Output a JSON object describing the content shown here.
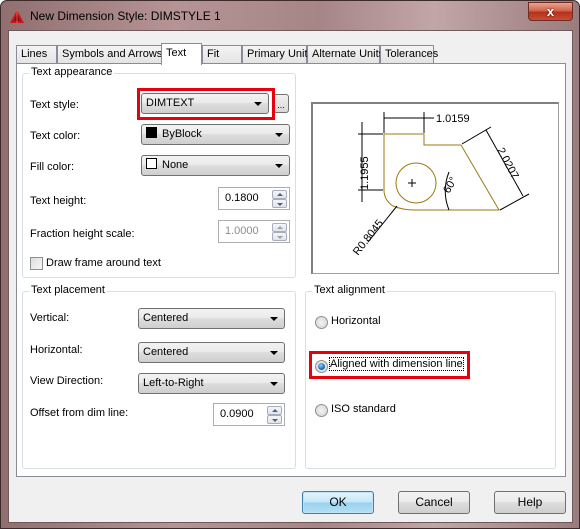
{
  "window": {
    "title": "New Dimension Style: DIMSTYLE 1",
    "close_label": "x"
  },
  "tabs": [
    {
      "label": "Lines",
      "active": false
    },
    {
      "label": "Symbols and Arrows",
      "active": false
    },
    {
      "label": "Text",
      "active": true
    },
    {
      "label": "Fit",
      "active": false
    },
    {
      "label": "Primary Units",
      "active": false
    },
    {
      "label": "Alternate Units",
      "active": false
    },
    {
      "label": "Tolerances",
      "active": false
    }
  ],
  "text_appearance": {
    "title": "Text appearance",
    "text_style_label": "Text style:",
    "text_style_value": "DIMTEXT",
    "text_style_browse": "...",
    "text_color_label": "Text color:",
    "text_color_value": "ByBlock",
    "text_color_swatch": "#000000",
    "fill_color_label": "Fill color:",
    "fill_color_value": "None",
    "fill_color_swatch": "#ffffff",
    "text_height_label": "Text height:",
    "text_height_value": "0.1800",
    "fraction_height_label": "Fraction height scale:",
    "fraction_height_value": "1.0000",
    "draw_frame_label": "Draw frame around text",
    "draw_frame_checked": false
  },
  "preview": {
    "dim_horizontal": "1.0159",
    "dim_vertical": "1.1955",
    "dim_aligned": "2.0207",
    "dim_angle": "60°",
    "dim_radius": "R0.8045",
    "outline_color": "#9c7a12"
  },
  "text_placement": {
    "title": "Text placement",
    "vertical_label": "Vertical:",
    "vertical_value": "Centered",
    "horizontal_label": "Horizontal:",
    "horizontal_value": "Centered",
    "view_direction_label": "View Direction:",
    "view_direction_value": "Left-to-Right",
    "offset_label": "Offset from dim line:",
    "offset_value": "0.0900"
  },
  "text_alignment": {
    "title": "Text alignment",
    "options": [
      {
        "label": "Horizontal",
        "checked": false
      },
      {
        "label": "Aligned with dimension line",
        "checked": true
      },
      {
        "label": "ISO standard",
        "checked": false
      }
    ]
  },
  "buttons": {
    "ok": "OK",
    "cancel": "Cancel",
    "help": "Help"
  },
  "highlight_color": "#e8000e"
}
